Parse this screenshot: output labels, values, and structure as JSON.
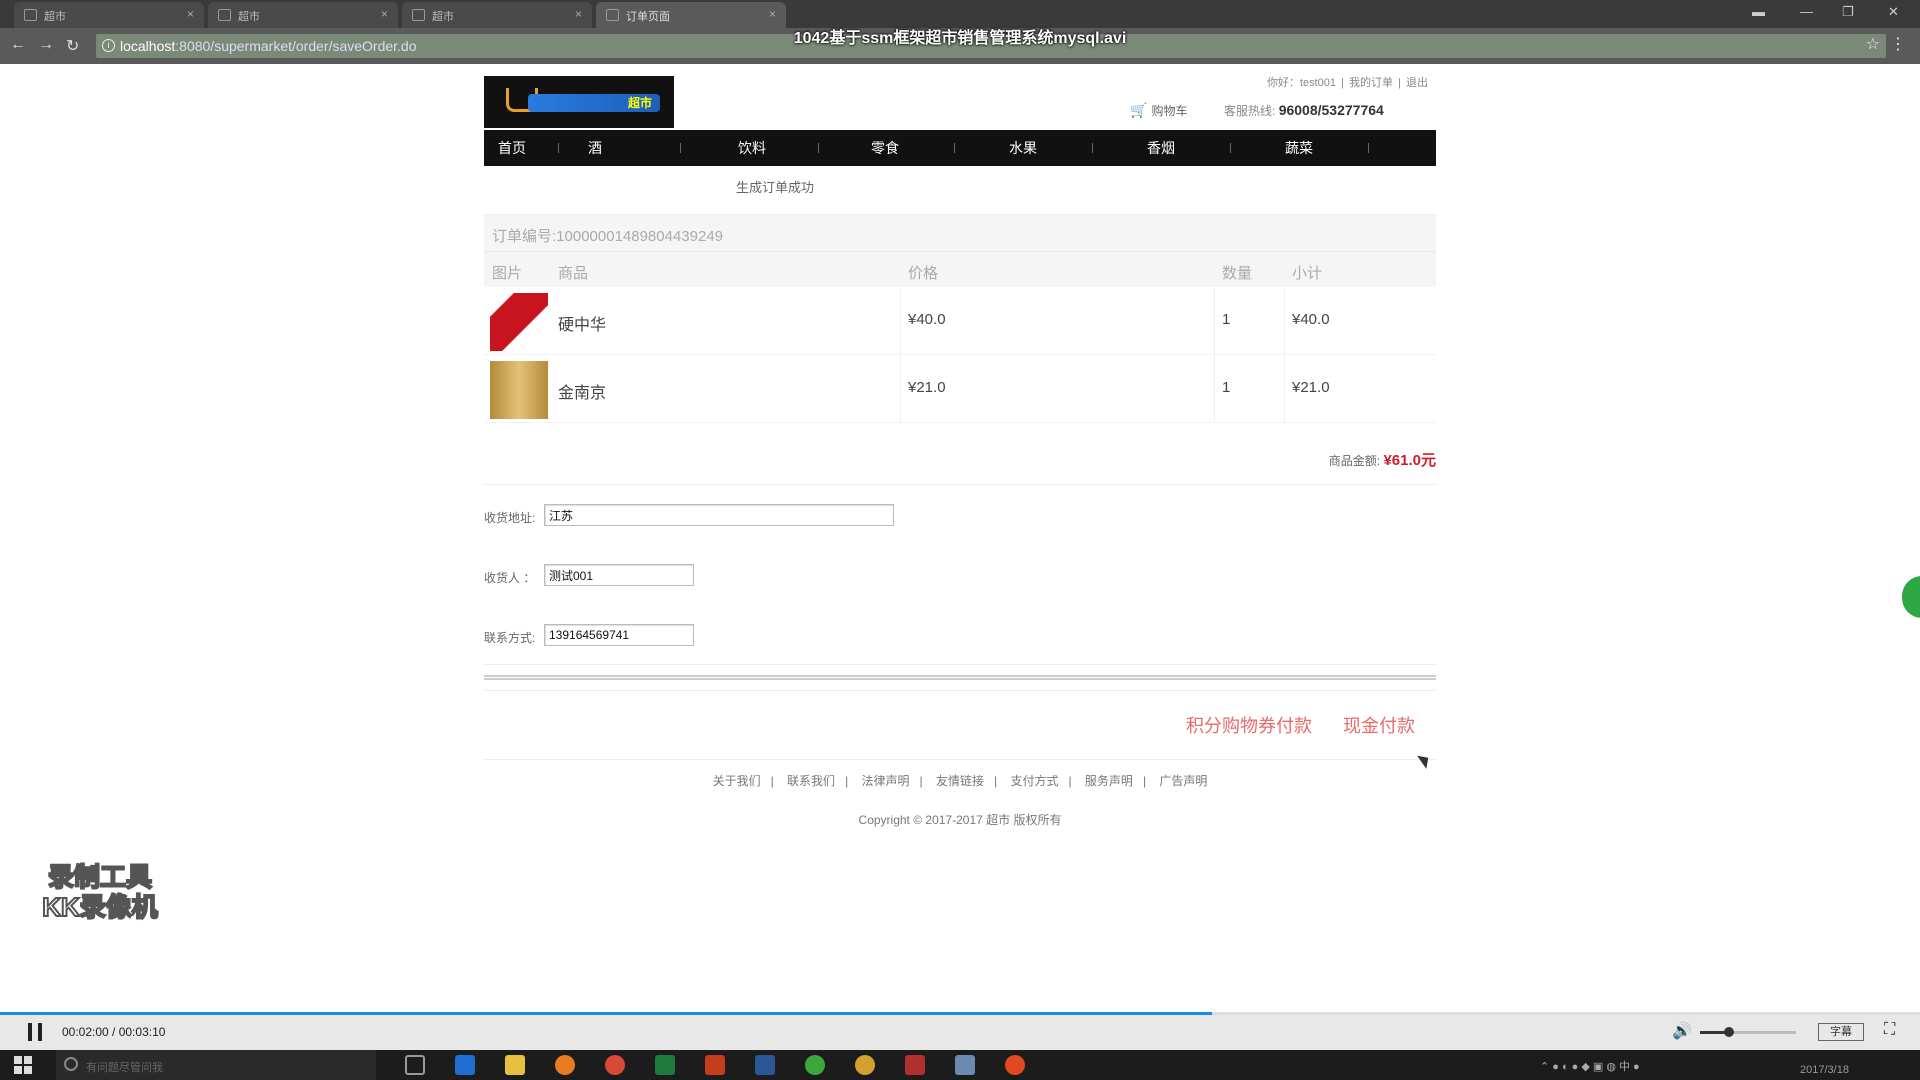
{
  "video_title": "1042基于ssm框架超市销售管理系统mysql.avi",
  "browser": {
    "tabs": [
      {
        "label": "超市",
        "active": false
      },
      {
        "label": "超市",
        "active": false
      },
      {
        "label": "超市",
        "active": false
      },
      {
        "label": "订单页面",
        "active": true
      }
    ],
    "url_host": "localhost",
    "url_path": ":8080/supermarket/order/saveOrder.do"
  },
  "header": {
    "logo_text": "超市",
    "greeting": "你好：test001",
    "my_orders": "我的订单",
    "logout": "退出",
    "cart_label": "购物车",
    "hotline_label": "客服热线:",
    "hotline_number": "96008/53277764"
  },
  "nav": [
    "首页",
    "酒",
    "饮料",
    "零食",
    "水果",
    "香烟",
    "蔬菜"
  ],
  "success_message": "生成订单成功",
  "order": {
    "number_label": "订单编号:",
    "number": "10000001489804439249",
    "columns": [
      "图片",
      "商品",
      "价格",
      "数量",
      "小计"
    ],
    "items": [
      {
        "name": "硬中华",
        "price": "¥40.0",
        "qty": "1",
        "subtotal": "¥40.0",
        "thumb_color": "#c8141e"
      },
      {
        "name": "金南京",
        "price": "¥21.0",
        "qty": "1",
        "subtotal": "¥21.0",
        "thumb_color": "#c9a24a"
      }
    ],
    "total_label": "商品金额:",
    "total_amount": "¥61.0元"
  },
  "form": {
    "address_label": "收货地址:",
    "address_value": "江苏",
    "receiver_label": "收货人 ：",
    "receiver_value": "测试001",
    "phone_label": "联系方式:",
    "phone_value": "139164569741"
  },
  "pay": {
    "points_label": "积分购物券付款",
    "cash_label": "现金付款"
  },
  "footer": {
    "links": [
      "关于我们",
      "联系我们",
      "法律声明",
      "友情链接",
      "支付方式",
      "服务声明",
      "广告声明"
    ],
    "copyright": "Copyright © 2017-2017 超市 版权所有"
  },
  "watermark": {
    "line1": "录制工具",
    "line2": "KK录像机"
  },
  "player": {
    "time": "00:02:00 / 00:03:10",
    "progress": 0.631,
    "volume": 0.3,
    "subtitle_label": "字幕"
  },
  "taskbar": {
    "search_placeholder": "有问题尽管问我",
    "date": "2017/3/18"
  },
  "colors": {
    "accent_red": "#d01c2a",
    "pay_link": "#e86a6a",
    "nav_bg": "#111111",
    "progress": "#1e88e5"
  }
}
